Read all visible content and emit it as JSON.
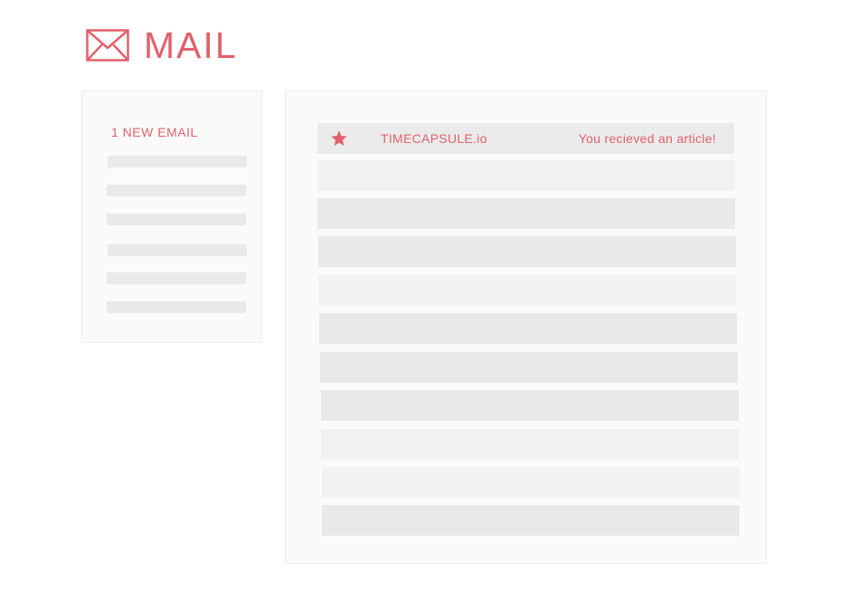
{
  "app": {
    "title": "MAIL",
    "logo_icon": "envelope-icon",
    "accent_color": "#e1616c"
  },
  "sidebar": {
    "new_count_label": "1 NEW EMAIL",
    "placeholder_items": 6
  },
  "inbox": {
    "featured": {
      "icon": "star-icon",
      "sender": "TIMECAPSULE.io",
      "subject": "You recieved an article!"
    },
    "placeholder_rows": 10
  }
}
